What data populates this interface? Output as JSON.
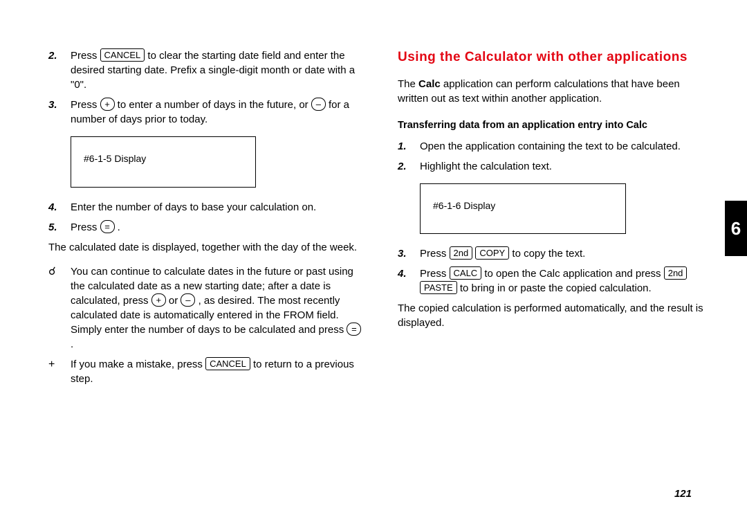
{
  "left": {
    "step2_pre": "Press ",
    "step2_key": "CANCEL",
    "step2_post": " to clear the starting date field and enter the desired starting date. Prefix a single-digit month or date with a \"0\".",
    "step3_pre": "Press ",
    "step3_key1": "+",
    "step3_mid": " to enter a number of days in the future, or ",
    "step3_key2": "–",
    "step3_post": " for a number of days prior to today.",
    "display1": "#6-1-5 Display",
    "step4": "Enter the number of days to base your calculation on.",
    "step5_pre": "Press ",
    "step5_key": "=",
    "step5_post": " .",
    "result_para": "The calculated date is displayed, together with the day of the week.",
    "tip_pre": "You can continue to calculate dates in the future or past using the calculated date as a new starting date; after a date is calculated, press ",
    "tip_k1": "+",
    "tip_mid1": " or ",
    "tip_k2": "–",
    "tip_mid2": " , as desired. The most recently calculated date is automatically entered in the FROM field. Simply enter the number of days to be calculated and press ",
    "tip_k3": "=",
    "tip_post": " .",
    "plus_pre": "If you make a mistake, press ",
    "plus_key": "CANCEL",
    "plus_post": " to return to a previous step."
  },
  "right": {
    "heading": "Using the Calculator with other applications",
    "intro_pre": "The ",
    "intro_bold": "Calc",
    "intro_post": " application can perform calculations that have been written out as text within another application.",
    "subhead": "Transferring data from an application entry into Calc",
    "r1": "Open the application containing the text to be calculated.",
    "r2": "Highlight the calculation text.",
    "display2": "#6-1-6 Display",
    "r3_pre": "Press ",
    "r3_k1": "2nd",
    "r3_k2": "COPY",
    "r3_post": " to copy the text.",
    "r4_pre": "Press ",
    "r4_k1": "CALC",
    "r4_mid": " to open the Calc application and press ",
    "r4_k2": "2nd",
    "r4_k3": "PASTE",
    "r4_post": " to bring in or paste the copied calculation.",
    "closing": "The copied calculation is performed automatically, and the result is displayed."
  },
  "page_number": "121",
  "tab": "6",
  "nums": {
    "n2": "2.",
    "n3": "3.",
    "n4": "4.",
    "n5": "5.",
    "n1": "1.",
    "plus": "+"
  }
}
